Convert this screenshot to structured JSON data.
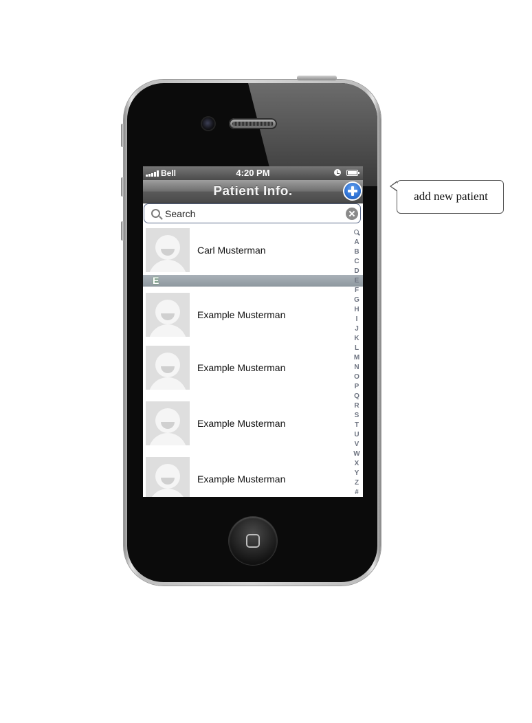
{
  "status_bar": {
    "carrier": "Bell",
    "time": "4:20 PM",
    "alarm_icon": "alarm-clock-icon",
    "battery_icon": "battery-icon"
  },
  "nav_bar": {
    "title": "Patient Info.",
    "add_icon": "plus-circle-icon",
    "accent_color": "#2f73d6"
  },
  "search": {
    "placeholder": "Search"
  },
  "patients_top": [
    {
      "name": "Carl Musterman"
    }
  ],
  "section": {
    "letter": "E"
  },
  "patients_bottom": [
    {
      "name": "Example Musterman"
    },
    {
      "name": "Example Musterman"
    },
    {
      "name": "Example Musterman"
    },
    {
      "name": "Example Musterman"
    }
  ],
  "index_letters": [
    "A",
    "B",
    "C",
    "D",
    "E",
    "F",
    "G",
    "H",
    "I",
    "J",
    "K",
    "L",
    "M",
    "N",
    "O",
    "P",
    "Q",
    "R",
    "S",
    "T",
    "U",
    "V",
    "W",
    "X",
    "Y",
    "Z",
    "#"
  ],
  "callout": {
    "text": "add new patient"
  }
}
